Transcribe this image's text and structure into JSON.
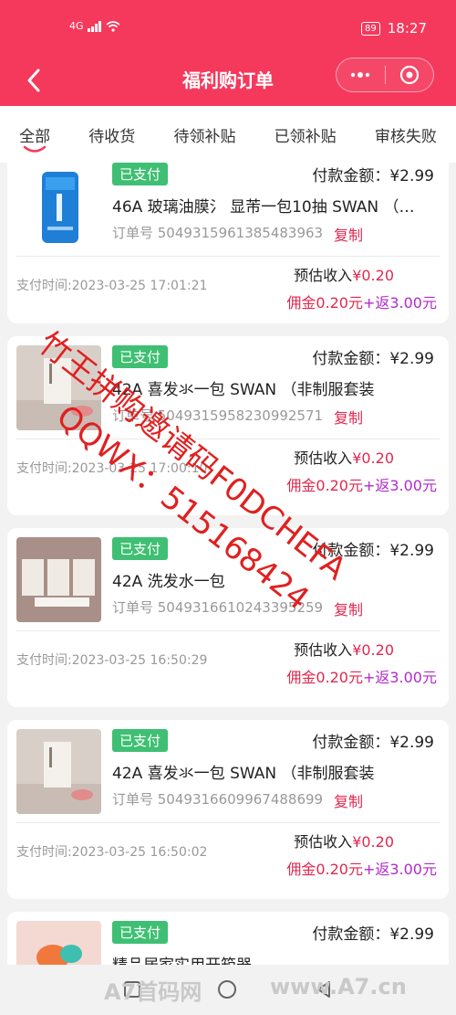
{
  "status_bar": {
    "network": "4G",
    "battery": "89",
    "time": "18:27"
  },
  "nav": {
    "title": "福利购订单"
  },
  "tabs": [
    {
      "label": "全部",
      "active": true
    },
    {
      "label": "待收货",
      "active": false
    },
    {
      "label": "待领补贴",
      "active": false
    },
    {
      "label": "已领补贴",
      "active": false
    },
    {
      "label": "审核失败",
      "active": false
    }
  ],
  "orders": [
    {
      "status": "已支付",
      "pay_label": "付款金额：¥2.99",
      "product": "46A 玻璃油膜氵 显芾一包10抽 SWAN （…",
      "order_no": "订单号 5049315961385483963",
      "copy": "复制",
      "pay_time": "支付时间:2023-03-25 17:01:21",
      "est_label": "预估收入",
      "est_value": "¥0.20",
      "commission": "佣金0.20元",
      "rebate": "+返3.00元"
    },
    {
      "status": "已支付",
      "pay_label": "付款金额：¥2.99",
      "product": "42A 喜发氺一包 SWAN （非制服套装",
      "order_no": "订单号 5049315958230992571",
      "copy": "复制",
      "pay_time": "支付时间:2023-03-25 17:00:10",
      "est_label": "预估收入",
      "est_value": "¥0.20",
      "commission": "佣金0.20元",
      "rebate": "+返3.00元"
    },
    {
      "status": "已支付",
      "pay_label": "付款金额：¥2.99",
      "product": "42A 洗发水一包",
      "order_no": "订单号 5049316610243395259",
      "copy": "复制",
      "pay_time": "支付时间:2023-03-25 16:50:29",
      "est_label": "预估收入",
      "est_value": "¥0.20",
      "commission": "佣金0.20元",
      "rebate": "+返3.00元"
    },
    {
      "status": "已支付",
      "pay_label": "付款金额：¥2.99",
      "product": "42A 喜发氺一包 SWAN （非制服套装",
      "order_no": "订单号 5049316609967488699",
      "copy": "复制",
      "pay_time": "支付时间:2023-03-25 16:50:02",
      "est_label": "预估收入",
      "est_value": "¥0.20",
      "commission": "佣金0.20元",
      "rebate": "+返3.00元"
    },
    {
      "status": "已支付",
      "pay_label": "付款金额：¥2.99",
      "product": "精品居家实用开箱器",
      "order_no": "",
      "copy": "",
      "pay_time": "",
      "est_label": "",
      "est_value": "",
      "commission": "",
      "rebate": ""
    }
  ],
  "watermark": {
    "line1": "竹王拼购邀请码F0DCHEFA",
    "line2": "QQWX：515168424"
  },
  "site_mark": {
    "left": "A7首码网",
    "right": "www.A7.cn"
  },
  "colors": {
    "brand": "#f5395d",
    "paid_badge": "#3fbf73",
    "accent_red": "#e0284f",
    "accent_purple": "#b02bc8"
  }
}
